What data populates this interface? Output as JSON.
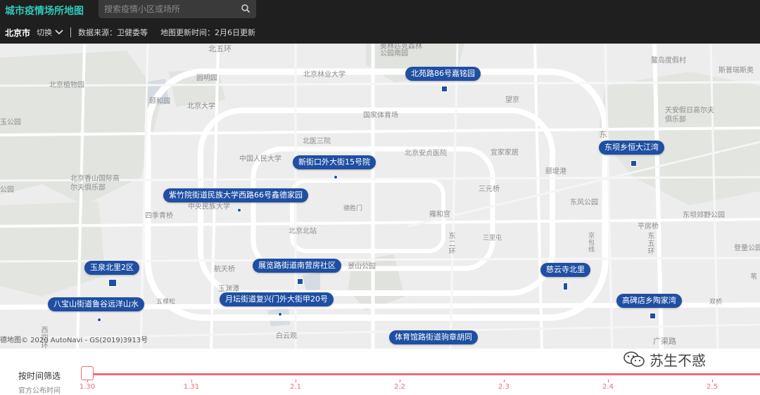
{
  "header": {
    "app_title": "城市疫情场所地图",
    "search_placeholder": "搜索疫情小区或场所",
    "city": "北京市",
    "switch_label": "切换",
    "data_source": "数据来源：卫健委等",
    "update_time": "地图更新时间：2月6日更新"
  },
  "map": {
    "place_labels": [
      "北五环",
      "奥林匹克森林公园南园",
      "北京植物园",
      "圆明园",
      "北京林业大学",
      "颐和园",
      "北京大学",
      "国家体育场",
      "望京",
      "鳌岛度假村",
      "斯普瑞斯奥",
      "天安假日高尔夫俱乐部",
      "北医三院",
      "中国人民大学",
      "北京安贞医院",
      "宜家家居",
      "颐堤港",
      "北京香山国际高尔夫俱乐部",
      "三元桥",
      "中央民族大学",
      "德胜门",
      "东风公园",
      "四季青桥",
      "雍和宫",
      "平房桥",
      "东坝郊野公园",
      "北京北站",
      "三里屯",
      "东二环",
      "京包线",
      "东五环",
      "航天桥",
      "景山公园",
      "登量公园",
      "玉渊潭",
      "五棵松",
      "双桥",
      "白云观",
      "广渠路",
      "西四环",
      "玉公园",
      "公园",
      "东",
      "苇"
    ],
    "copyright": "德地图© 2020 AutoNavi - GS(2019)3913号",
    "outbreak_locations": [
      "北苑路86号嘉铭园",
      "新街口外大街15号院",
      "紫竹院街道民族大学西路66号鑫德家园",
      "东坝乡恒大江湾",
      "玉泉北里2区",
      "展览路街道南营房社区",
      "慈云寺北里",
      "八宝山街道鲁谷远洋山水",
      "月坛街道复兴门外大街甲20号",
      "高碑店乡陶家湾",
      "体育馆路街道驹章胡同"
    ]
  },
  "timeline": {
    "label": "按时间筛选",
    "sub_label": "官方公布时间",
    "ticks": [
      "1.30",
      "1.31",
      "2.1",
      "2.2",
      "2.3",
      "2.4",
      "2.5"
    ],
    "selected": "1.30"
  },
  "watermark": {
    "text": "苏生不惑"
  },
  "colors": {
    "accent": "#31c6b8",
    "pin": "#1f4fa3",
    "timeline": "#f06a79",
    "topbar": "#1f1f1f"
  }
}
